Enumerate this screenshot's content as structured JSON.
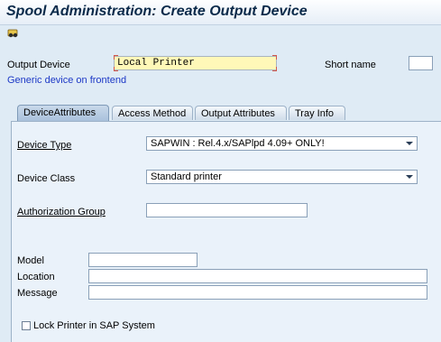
{
  "window": {
    "title": "Spool Administration: Create Output Device"
  },
  "toolbar": {
    "icon": "glasses-icon"
  },
  "header": {
    "output_device_label": "Output Device",
    "output_device_value": "Local Printer",
    "short_name_label": "Short name",
    "short_name_value": "",
    "generic_link": "Generic device on frontend"
  },
  "tabs": [
    {
      "label": "DeviceAttributes",
      "active": true
    },
    {
      "label": "Access Method",
      "active": false
    },
    {
      "label": "Output Attributes",
      "active": false
    },
    {
      "label": "Tray Info",
      "active": false
    }
  ],
  "form": {
    "device_type_label": "Device Type",
    "device_type_value": "SAPWIN    : Rel.4.x/SAPlpd 4.09+ ONLY!",
    "device_class_label": "Device Class",
    "device_class_value": "Standard printer",
    "auth_group_label": "Authorization Group",
    "auth_group_value": "",
    "model_label": "Model",
    "model_value": "",
    "location_label": "Location",
    "location_value": "",
    "message_label": "Message",
    "message_value": "",
    "lock_label": "Lock Printer in SAP System",
    "lock_checked": false
  }
}
